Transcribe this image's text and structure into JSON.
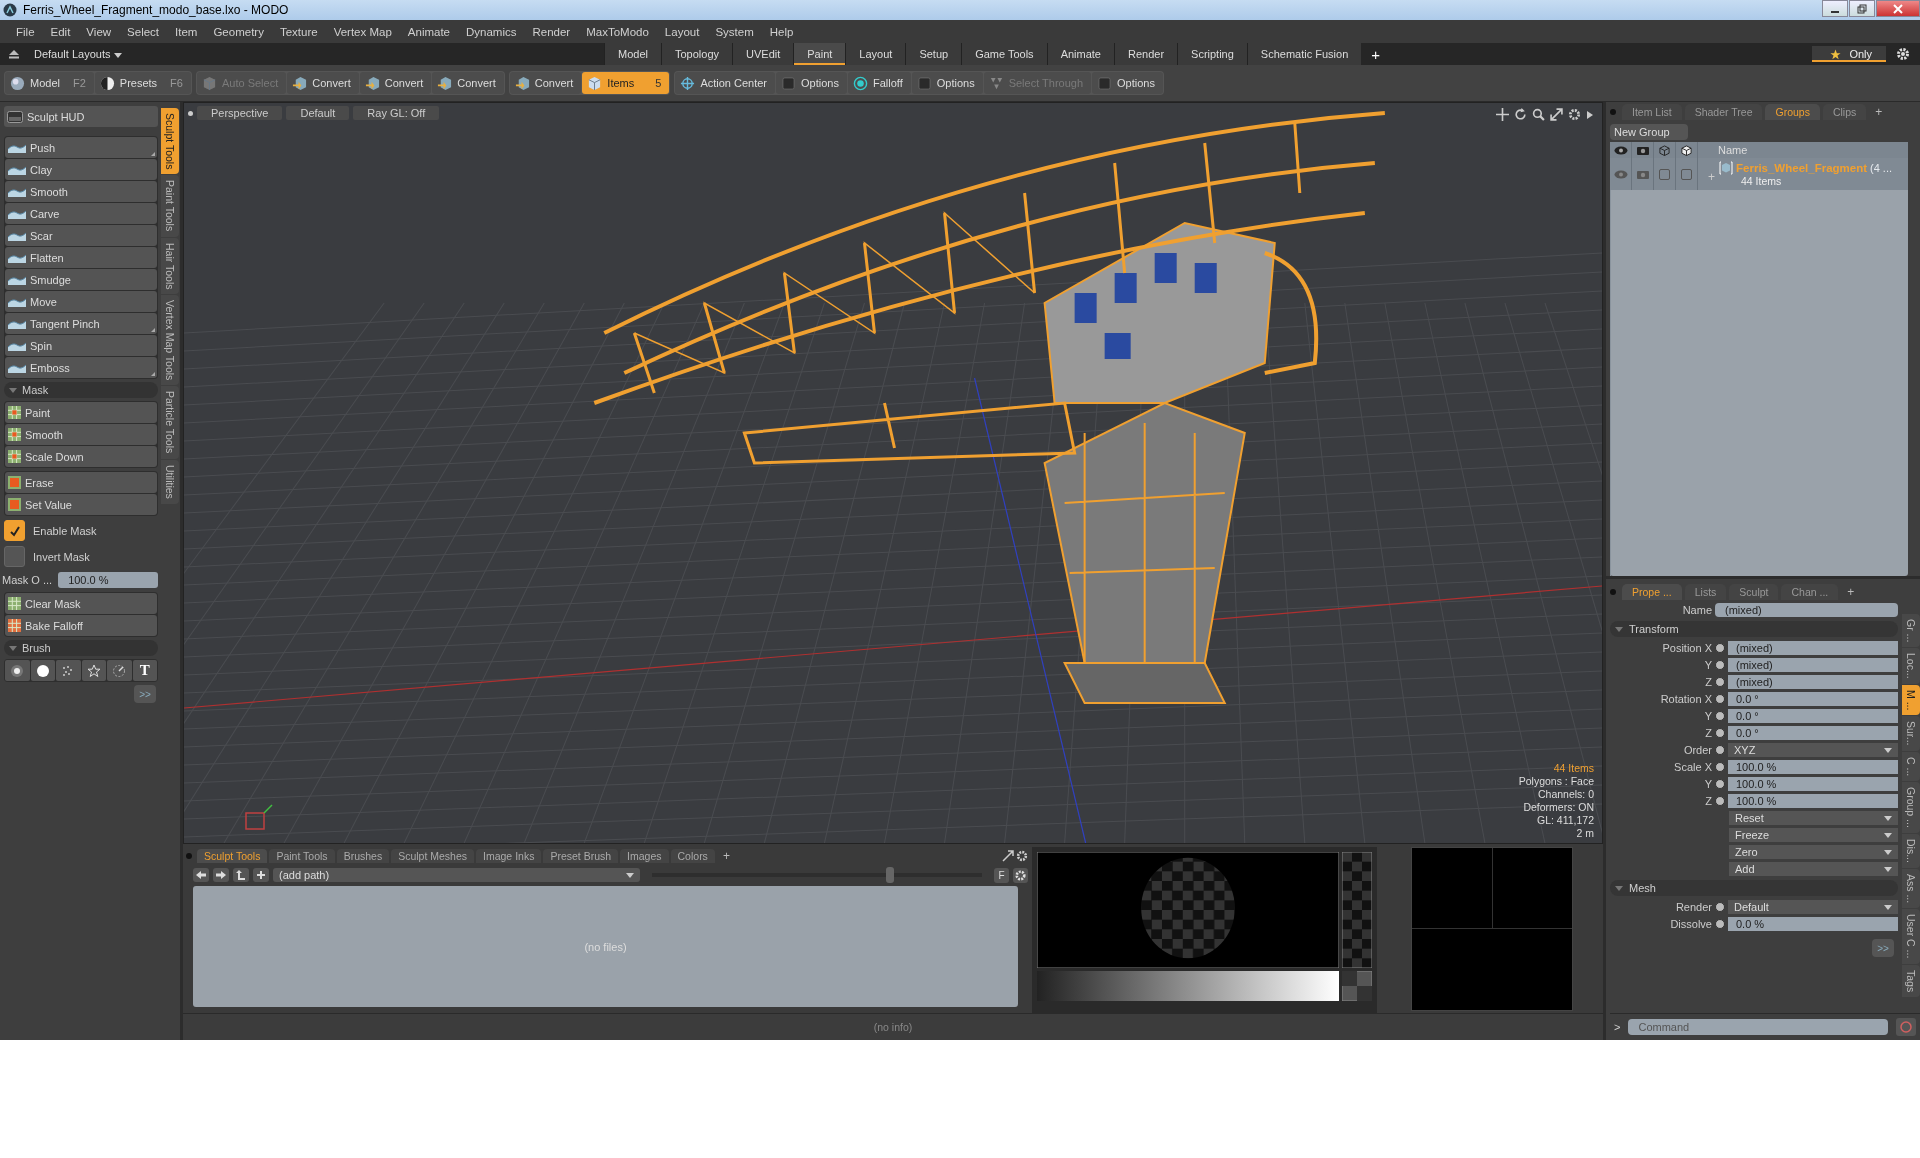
{
  "window": {
    "title": "Ferris_Wheel_Fragment_modo_base.lxo - MODO"
  },
  "menu": [
    "File",
    "Edit",
    "View",
    "Select",
    "Item",
    "Geometry",
    "Texture",
    "Vertex Map",
    "Animate",
    "Dynamics",
    "Render",
    "MaxToModo",
    "Layout",
    "System",
    "Help"
  ],
  "layout_selector": "Default Layouts",
  "layout_tabs": [
    {
      "label": "Model",
      "selected": false
    },
    {
      "label": "Topology",
      "selected": false
    },
    {
      "label": "UVEdit",
      "selected": false
    },
    {
      "label": "Paint",
      "selected": true
    },
    {
      "label": "Layout",
      "selected": false
    },
    {
      "label": "Setup",
      "selected": false
    },
    {
      "label": "Game Tools",
      "selected": false
    },
    {
      "label": "Animate",
      "selected": false
    },
    {
      "label": "Render",
      "selected": false
    },
    {
      "label": "Scripting",
      "selected": false
    },
    {
      "label": "Schematic Fusion",
      "selected": false
    }
  ],
  "layout_add": "+",
  "layout_filter": "Only",
  "toolbar_groups": [
    [
      {
        "kind": "sphere",
        "label": "Model",
        "shortcut": "F2",
        "disabled": false,
        "selected": false
      },
      {
        "kind": "presets",
        "label": "Presets",
        "shortcut": "F6",
        "disabled": false,
        "selected": false
      }
    ],
    [
      {
        "kind": "auto",
        "label": "Auto Select",
        "disabled": true,
        "selected": false
      },
      {
        "kind": "convert",
        "label": "Convert",
        "disabled": false,
        "selected": false
      },
      {
        "kind": "convert",
        "label": "Convert",
        "disabled": false,
        "selected": false
      },
      {
        "kind": "convert",
        "label": "Convert",
        "disabled": false,
        "selected": false
      }
    ],
    [
      {
        "kind": "convert",
        "label": "Convert",
        "disabled": false,
        "selected": false
      },
      {
        "kind": "items",
        "label": "Items",
        "shortcut": "5",
        "disabled": false,
        "selected": true
      }
    ],
    [
      {
        "kind": "action",
        "label": "Action Center",
        "disabled": false,
        "selected": false
      },
      {
        "kind": "options",
        "label": "Options",
        "disabled": false,
        "selected": false
      },
      {
        "kind": "falloff",
        "label": "Falloff",
        "disabled": false,
        "selected": false
      },
      {
        "kind": "options",
        "label": "Options",
        "disabled": false,
        "selected": false
      },
      {
        "kind": "through",
        "label": "Select Through",
        "disabled": true,
        "selected": false
      },
      {
        "kind": "options",
        "label": "Options",
        "disabled": false,
        "selected": false
      }
    ]
  ],
  "left_panel": {
    "hud": "Sculpt HUD",
    "sculpt_tools": [
      {
        "label": "Push",
        "submenu": true
      },
      {
        "label": "Clay",
        "submenu": false
      },
      {
        "label": "Smooth",
        "submenu": false
      },
      {
        "label": "Carve",
        "submenu": false
      },
      {
        "label": "Scar",
        "submenu": false
      },
      {
        "label": "Flatten",
        "submenu": false
      },
      {
        "label": "Smudge",
        "submenu": false
      },
      {
        "label": "Move",
        "submenu": false
      },
      {
        "label": "Tangent Pinch",
        "submenu": true
      },
      {
        "label": "Spin",
        "submenu": false
      },
      {
        "label": "Emboss",
        "submenu": true
      }
    ],
    "mask_title": "Mask",
    "mask_tools": [
      "Paint",
      "Smooth",
      "Scale Down"
    ],
    "mask_tools_2": [
      "Erase",
      "Set Value"
    ],
    "mask_toggles": [
      {
        "label": "Enable Mask",
        "checked": true
      },
      {
        "label": "Invert Mask",
        "checked": false
      }
    ],
    "mask_opacity": {
      "label": "Mask O ...",
      "value": "100.0 %"
    },
    "mask_actions": [
      "Clear Mask",
      "Bake Falloff"
    ],
    "brush_title": "Brush",
    "brush_shapes": [
      {
        "kind": "soft"
      },
      {
        "kind": "solid"
      },
      {
        "kind": "spray"
      },
      {
        "kind": "star"
      },
      {
        "kind": "dial"
      },
      {
        "kind": "text",
        "label": "T"
      }
    ],
    "more": ">>"
  },
  "left_tabs": [
    {
      "label": "Sculpt Tools",
      "selected": true
    },
    {
      "label": "Paint Tools",
      "selected": false
    },
    {
      "label": "Hair Tools",
      "selected": false
    },
    {
      "label": "Vertex Map Tools",
      "selected": false
    },
    {
      "label": "Particle Tools",
      "selected": false
    },
    {
      "label": "Utilities",
      "selected": false
    }
  ],
  "viewport": {
    "header": [
      "Perspective",
      "Default",
      "Ray GL: Off"
    ],
    "info": [
      "44 Items",
      "Polygons : Face",
      "Channels: 0",
      "Deformers: ON",
      "GL: 411,172",
      "2 m"
    ]
  },
  "bottom_panel": {
    "tabs": [
      {
        "label": "Sculpt Tools",
        "selected": true
      },
      {
        "label": "Paint Tools",
        "selected": false
      },
      {
        "label": "Brushes",
        "selected": false
      },
      {
        "label": "Sculpt Meshes",
        "selected": false
      },
      {
        "label": "Image Inks",
        "selected": false
      },
      {
        "label": "Preset Brush",
        "selected": false
      },
      {
        "label": "Images",
        "selected": false
      },
      {
        "label": "Colors",
        "selected": false
      }
    ],
    "add_tab": "+",
    "path": "(add path)",
    "zoom": {
      "level": 0.72
    },
    "filter_button": "F",
    "empty": "(no files)"
  },
  "status_bar": "(no info)",
  "groups_panel": {
    "tabs": [
      {
        "label": "Item List",
        "selected": false
      },
      {
        "label": "Shader Tree",
        "selected": false
      },
      {
        "label": "Groups",
        "selected": true
      },
      {
        "label": "Clips",
        "selected": false
      }
    ],
    "add_tab": "+",
    "new_group": "New Group",
    "name_column": "Name",
    "rows": [
      {
        "expander": "+",
        "name": "Ferris_Wheel_Fragment",
        "suffix": "(4 ...",
        "count": "44 Items"
      }
    ]
  },
  "properties": {
    "tabs": [
      {
        "label": "Prope ...",
        "selected": true
      },
      {
        "label": "Lists",
        "selected": false
      },
      {
        "label": "Sculpt",
        "selected": false
      },
      {
        "label": "Chan ...",
        "selected": false
      }
    ],
    "add_tab": "+",
    "name_label": "Name",
    "name_value": "(mixed)",
    "sections": [
      {
        "title": "Transform",
        "rows": [
          {
            "kind": "field",
            "label": "Position X",
            "value": "(mixed)"
          },
          {
            "kind": "field",
            "label": "Y",
            "value": "(mixed)"
          },
          {
            "kind": "field",
            "label": "Z",
            "value": "(mixed)"
          },
          {
            "kind": "field",
            "label": "Rotation X",
            "value": "0.0 °"
          },
          {
            "kind": "field",
            "label": "Y",
            "value": "0.0 °"
          },
          {
            "kind": "field",
            "label": "Z",
            "value": "0.0 °"
          },
          {
            "kind": "dropdown",
            "label": "Order",
            "value": "XYZ"
          },
          {
            "kind": "field",
            "label": "Scale X",
            "value": "100.0 %"
          },
          {
            "kind": "field",
            "label": "Y",
            "value": "100.0 %"
          },
          {
            "kind": "field",
            "label": "Z",
            "value": "100.0 %"
          },
          {
            "kind": "action",
            "value": "Reset"
          },
          {
            "kind": "action",
            "value": "Freeze"
          },
          {
            "kind": "action",
            "value": "Zero"
          },
          {
            "kind": "action",
            "value": "Add"
          }
        ]
      },
      {
        "title": "Mesh",
        "rows": [
          {
            "kind": "dropdown",
            "label": "Render",
            "value": "Default"
          },
          {
            "kind": "field",
            "label": "Dissolve",
            "value": "0.0 %"
          }
        ]
      }
    ],
    "more": ">>",
    "side_tabs": [
      {
        "label": "Gr ...",
        "selected": false
      },
      {
        "label": "Loc...",
        "selected": false
      },
      {
        "label": "M ...",
        "selected": true
      },
      {
        "label": "Sur...",
        "selected": false
      },
      {
        "label": "C ...",
        "selected": false
      },
      {
        "label": "Group ...",
        "selected": false
      },
      {
        "label": "Dis...",
        "selected": false
      },
      {
        "label": "Ass ...",
        "selected": false
      },
      {
        "label": "User C ...",
        "selected": false
      },
      {
        "label": "Tags",
        "selected": false
      }
    ]
  },
  "command": {
    "prompt": ">",
    "placeholder": "Command"
  }
}
